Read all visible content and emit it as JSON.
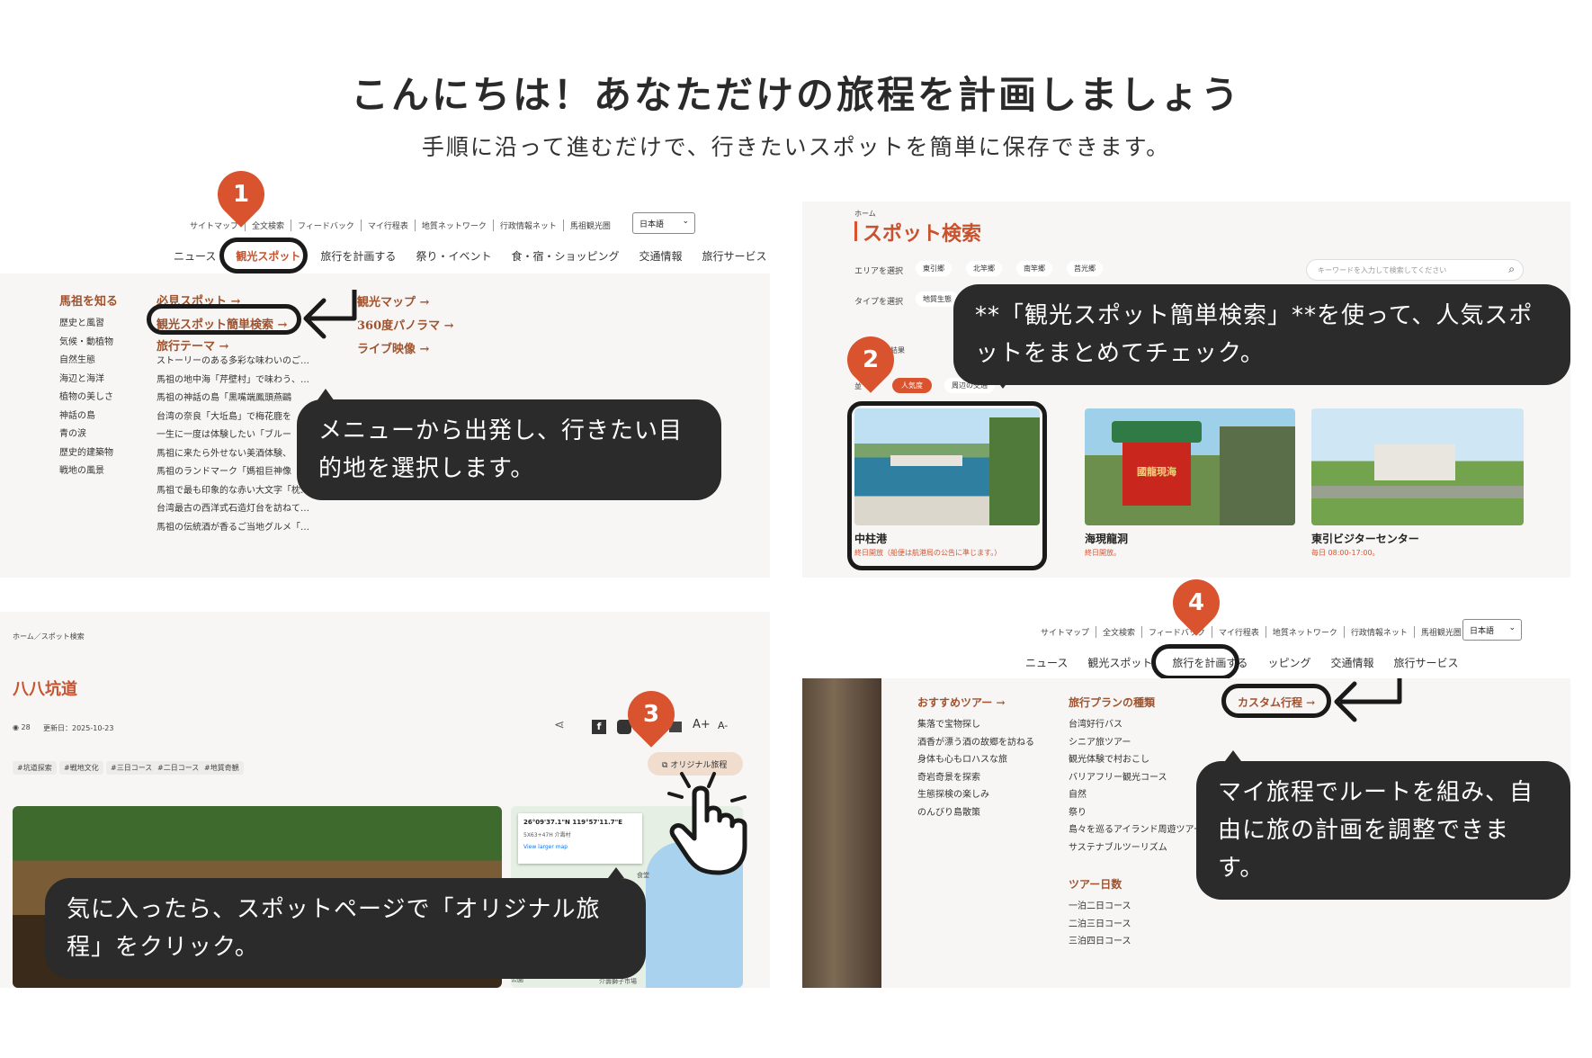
{
  "header": {
    "title": "こんにちは！あなただけの旅程を計画しましょう",
    "subtitle": "手順に沿って進むだけで、行きたいスポットを簡単に保存できます。"
  },
  "colors": {
    "accent": "#d9532f",
    "callout": "#2b2b2b",
    "heading": "#a0522d"
  },
  "step1": {
    "pin": "1",
    "utility": [
      "サイトマップ",
      "全文検索",
      "フィードバック",
      "マイ行程表",
      "地質ネットワーク",
      "行政情報ネット",
      "馬祖観光圏"
    ],
    "language": "日本語",
    "nav": [
      "ニュース",
      "観光スポット",
      "旅行を計画する",
      "祭り・イベント",
      "食・宿・ショッピング",
      "交通情報",
      "旅行サービス"
    ],
    "col1_heading": "馬祖を知る",
    "col1_items": [
      "歴史と風習",
      "気候・動植物",
      "自然生態",
      "海辺と海洋",
      "植物の美しさ",
      "神話の島",
      "青の涙",
      "歴史的建築物",
      "戦地の風景"
    ],
    "col2_heading": "必見スポット →",
    "col2_highlight": "観光スポット簡単検索 →",
    "col2_theme": "旅行テーマ →",
    "col2_items": [
      "ストーリーのある多彩な味わいのご…",
      "馬祖の地中海「芹壁村」で味わう、…",
      "馬祖の神話の島「黒嘴端鳳頭燕鷗",
      "台湾の奈良「大坵島」で梅花鹿を",
      "一生に一度は体験したい「ブルー",
      "馬祖に来たら外せない美酒体験、",
      "馬祖のランドマーク「媽祖巨神像",
      "馬祖で最も印象的な赤い大文字「枕…",
      "台湾最古の西洋式石造灯台を訪ねて…",
      "馬祖の伝統酒が香るご当地グルメ「…"
    ],
    "col3_items": [
      "観光マップ →",
      "360度パノラマ →",
      "ライブ映像 →"
    ],
    "callout": "メニューから出発し、行きたい目的地を選択します。"
  },
  "step2": {
    "pin": "2",
    "breadcrumb": "ホーム",
    "page_title": "スポット検索",
    "area_label": "エリアを選択",
    "areas": [
      "東引郷",
      "北竿郷",
      "南竿郷",
      "莒光郷"
    ],
    "type_label": "タイプを選択",
    "type_chip": "地質生態",
    "search_placeholder": "キーワードを入力して検索してください",
    "results_label": "の結果",
    "sort_chips": [
      "人気度",
      "周辺の交通"
    ],
    "sort_prefix": "並",
    "callout": "**「観光スポット簡単検索」**を使って、人気スポットをまとめてチェック。",
    "cards": [
      {
        "name": "中柱港",
        "sub": "終日開放（船便は航港局の公告に準じます。）"
      },
      {
        "name": "海現龍洞",
        "sub": "終日開放。"
      },
      {
        "name": "東引ビジターセンター",
        "sub": "毎日 08:00-17:00。"
      }
    ],
    "sign_text": "國龍現海"
  },
  "step3": {
    "pin": "3",
    "breadcrumb": "ホーム／スポット検索",
    "page_title": "八八坑道",
    "views": "28",
    "updated": "更新日：2025-10-23",
    "tags": [
      "#坑道探索",
      "#戦地文化",
      "#三日コース",
      "#二日コース",
      "#地質奇観"
    ],
    "font_up": "A+",
    "font_down": "A-",
    "original_button": "オリジナル旅程",
    "map_coords": "26°09'37.1\"N 119°57'11.7\"E",
    "map_code": "5X63+47H 介壽村",
    "map_link": "View larger map",
    "map_label1": "食堂",
    "map_label2": "介壽獅子市場",
    "map_label3": "公園",
    "callout": "気に入ったら、スポットページで「オリジナル旅程」をクリック。"
  },
  "step4": {
    "pin": "4",
    "utility": [
      "サイトマップ",
      "全文検索",
      "フィードバック",
      "マイ行程表",
      "地質ネットワーク",
      "行政情報ネット",
      "馬祖観光圏"
    ],
    "language": "日本語",
    "nav": [
      "ニュース",
      "観光スポット",
      "旅行を計画する",
      "ッピング",
      "交通情報",
      "旅行サービス"
    ],
    "col1_heading": "おすすめツアー →",
    "col1_items": [
      "集落で宝物探し",
      "酒香が漂う酒の故郷を訪ねる",
      "身体も心もロハスな旅",
      "奇岩奇景を探索",
      "生態探検の楽しみ",
      "のんびり島散策"
    ],
    "col2_heading": "旅行プランの種類",
    "col2_items": [
      "台湾好行バス",
      "シニア旅ツアー",
      "観光体験で村おこし",
      "バリアフリー観光コース",
      "自然",
      "祭り",
      "島々を巡るアイランド周遊ツアー",
      "サステナブルツーリズム"
    ],
    "col2_heading2": "ツアー日数",
    "col2_items2": [
      "一泊二日コース",
      "二泊三日コース",
      "三泊四日コース"
    ],
    "custom": "カスタム行程 →",
    "callout": "マイ旅程でルートを組み、自由に旅の計画を調整できます。"
  }
}
